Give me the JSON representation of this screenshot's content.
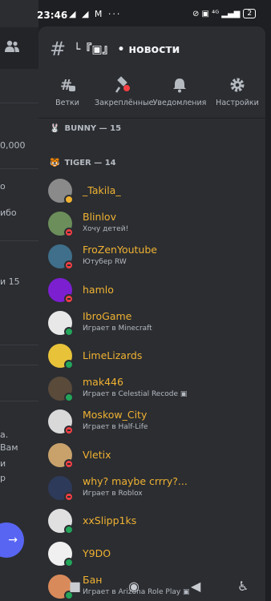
{
  "status_bar": {
    "time": "23:46",
    "left_icons": "◢ ◢ M ···",
    "right_info": "⊘ ▣ ⁴ᴳ ▂▄▆",
    "battery": "2"
  },
  "background": {
    "peek_texts": [
      "0,000",
      "о",
      "ибо",
      "и 15",
      "а.",
      "Вам",
      "и",
      "р"
    ],
    "send_icon": "→"
  },
  "channel": {
    "hash": "#",
    "name": "└『▣』 • новости"
  },
  "toolbar": [
    {
      "icon": "threads-icon",
      "label": "Ветки"
    },
    {
      "icon": "pin-icon",
      "label": "Закреплённые"
    },
    {
      "icon": "bell-icon",
      "label": "Уведомления"
    },
    {
      "icon": "gear-icon",
      "label": "Настройки"
    }
  ],
  "roles": [
    {
      "emoji": "🐰",
      "label": "BUNNY — 15"
    },
    {
      "emoji": "🐯",
      "label": "TIGER — 14"
    }
  ],
  "members": [
    {
      "name": "_Takila_",
      "sub": "",
      "status": "idle",
      "color": "#8a8a8a"
    },
    {
      "name": "Blinlov",
      "sub": "Хочу детей!",
      "status": "dnd",
      "color": "#6b8e5a"
    },
    {
      "name": "FroZenYoutube",
      "sub": "Ютубер RW",
      "status": "dnd",
      "color": "#3f6f8a"
    },
    {
      "name": "hamlo",
      "sub": "",
      "status": "dnd",
      "color": "#7c1fd1"
    },
    {
      "name": "IbroGame",
      "sub": "Играет в Minecraft",
      "status": "online",
      "color": "#e8e8e8"
    },
    {
      "name": "LimeLizards",
      "sub": "",
      "status": "online",
      "color": "#e8c33a"
    },
    {
      "name": "mak446",
      "sub": "Играет в Celestial Recode ▣",
      "status": "online",
      "color": "#5a4a3a"
    },
    {
      "name": "Moskow_City",
      "sub": "Играет в Half-Life",
      "status": "dnd",
      "color": "#d9d9d9"
    },
    {
      "name": "Vletix",
      "sub": "",
      "status": "dnd",
      "color": "#c9a26b"
    },
    {
      "name": "why? maybe crrry?...",
      "sub": "Играет в Roblox",
      "status": "dnd",
      "color": "#2d3a5a"
    },
    {
      "name": "xxSlipp1ks",
      "sub": "",
      "status": "online",
      "color": "#e0e0e0"
    },
    {
      "name": "Y9DO",
      "sub": "",
      "status": "online",
      "color": "#f0f0f0"
    },
    {
      "name": "Бан",
      "sub": "Играет в Arizona Role Play ▣",
      "status": "online",
      "color": "#d98a5a"
    }
  ],
  "nav_buttons": [
    "■",
    "◉",
    "◀",
    "♿"
  ],
  "colors": {
    "member_name": "#f0b232",
    "background": "#2b2d31",
    "accent": "#5865f2"
  }
}
